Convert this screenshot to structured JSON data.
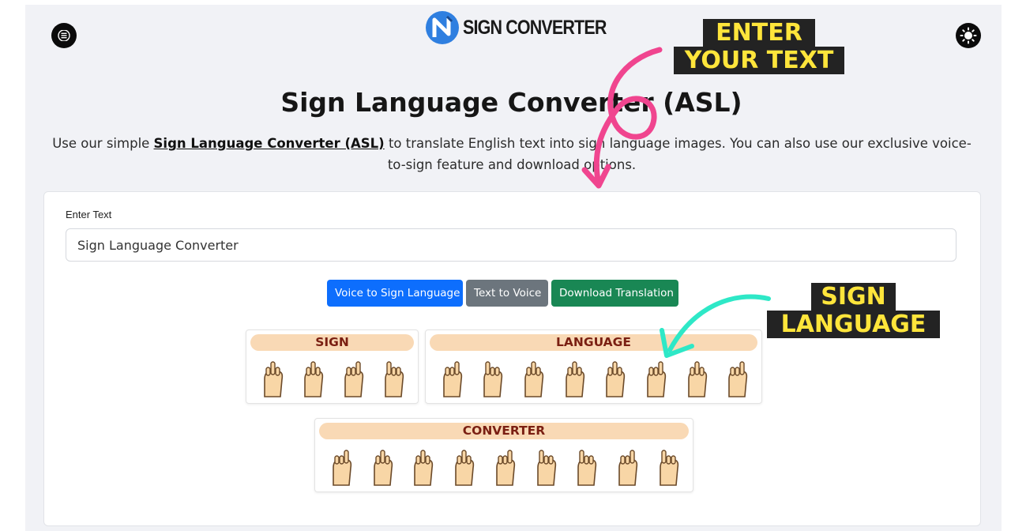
{
  "header": {
    "menu_icon": "hamburger-menu-icon",
    "logo_icon": "sign-converter-logo-icon",
    "logo_text": "SIGN CONVERTER",
    "theme_icon": "sun-icon"
  },
  "hero": {
    "title": "Sign Language Converter (ASL)",
    "intro_before": "Use our simple ",
    "intro_link": "Sign Language Converter (ASL)",
    "intro_after": " to translate English text into sign language images. You can also use our exclusive voice-to-sign feature and download options."
  },
  "form": {
    "label": "Enter Text",
    "value": "Sign Language Converter"
  },
  "buttons": {
    "voice_to_sign": "Voice to Sign Language",
    "text_to_voice": "Text to Voice",
    "download": "Download Translation"
  },
  "words": [
    {
      "label": "SIGN",
      "signs": [
        "S",
        "I",
        "G",
        "N"
      ]
    },
    {
      "label": "LANGUAGE",
      "signs": [
        "L",
        "A",
        "N",
        "G",
        "U",
        "A",
        "G",
        "E"
      ]
    },
    {
      "label": "CONVERTER",
      "signs": [
        "C",
        "O",
        "N",
        "V",
        "E",
        "R",
        "T",
        "E",
        "R"
      ]
    }
  ],
  "callouts": {
    "enter_line1": "ENTER",
    "enter_line2": "YOUR TEXT",
    "sign_line1": "SIGN",
    "sign_line2": "LANGUAGE"
  },
  "colors": {
    "primary": "#0d6efd",
    "secondary": "#6c757d",
    "success": "#198754",
    "callout_text": "#ffe53b",
    "callout_bg": "#232323",
    "arrow_pink": "#f0458f",
    "arrow_teal": "#2ee8c7"
  }
}
